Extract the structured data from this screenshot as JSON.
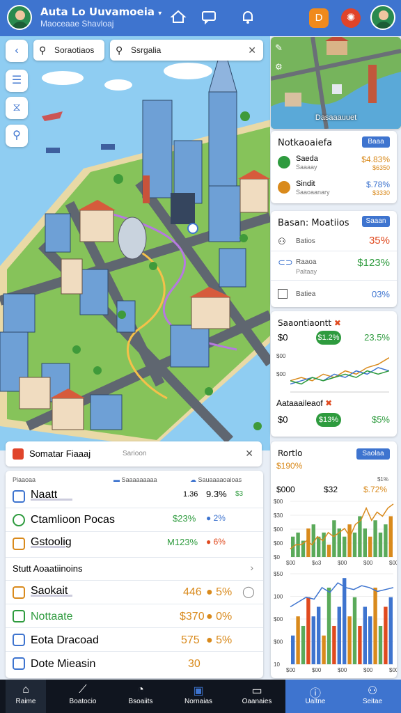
{
  "header": {
    "title": "Auta Lo Uuvamoeia",
    "title_suffix": "▾",
    "subtitle": "Maoceaae Shavloaj",
    "icons": [
      "home-icon",
      "chat-icon",
      "notification-icon",
      "document-icon",
      "settings-icon"
    ]
  },
  "search": {
    "left_text": "Soraotiaos",
    "right_text": "Ssrgalia"
  },
  "map": {
    "minimap_label": "Dasaaauuet"
  },
  "market_card": {
    "title": "Notkaoaiefa",
    "button": "Baaa",
    "rows": [
      {
        "name": "Saeda",
        "sub": "Saaaay",
        "value": "$4.83%",
        "sub_value": "$6350"
      },
      {
        "name": "Sindit",
        "sub": "Saaoaanary",
        "value": "$.78%",
        "sub_value": "$3330"
      }
    ]
  },
  "monitor_card": {
    "title": "Basan: Moatiios",
    "button": "Saaan",
    "rows": [
      {
        "name": "Batios",
        "value": "35%"
      },
      {
        "name": "Raaoa",
        "sub": "Paltaay",
        "value": "$123%"
      },
      {
        "name": "Batiea",
        "value": "03%"
      }
    ]
  },
  "stats_card": {
    "title": "Saaontiaontt",
    "flag": "✖",
    "a_label": "$0",
    "a_pill": "$1.2%",
    "a_value": "23.5%",
    "chart_ylabels": [
      "$00",
      "$00"
    ],
    "b_title": "Aataaaileaof",
    "b_label": "$0",
    "b_pill": "$13%",
    "b_value": "$5%"
  },
  "chart_data": [
    {
      "type": "line",
      "series": [
        {
          "values": [
            3,
            4,
            3,
            5,
            4,
            6,
            5,
            7,
            8,
            10
          ],
          "color": "#d98a1c"
        },
        {
          "values": [
            2,
            3,
            4,
            3,
            5,
            4,
            6,
            5,
            7,
            6
          ],
          "color": "#3e74cf"
        },
        {
          "values": [
            3,
            2,
            4,
            3,
            4,
            5,
            4,
            6,
            5,
            6
          ],
          "color": "#2e9b3e"
        }
      ]
    },
    {
      "type": "bar",
      "title": "Rortlo",
      "button": "Saolaa",
      "value": "$190%",
      "stats": [
        "$000",
        "$32",
        "$.72%"
      ],
      "stat_note": "$1%",
      "ylabels": [
        "$00",
        "$30",
        "$00",
        "$00",
        "$0"
      ],
      "xlabels": [
        "$00",
        "$o3",
        "$00",
        "$00",
        "$00"
      ],
      "values": [
        5,
        6,
        4,
        7,
        8,
        5,
        6,
        3,
        9,
        7,
        5,
        8,
        6,
        10,
        7,
        5,
        9,
        6,
        8,
        10
      ],
      "line": [
        2,
        3,
        3,
        4,
        3,
        5,
        4,
        6,
        5,
        6,
        7,
        5,
        8,
        9,
        12,
        9,
        11,
        10,
        12,
        13
      ]
    },
    {
      "type": "bar",
      "ylabels": [
        "$50",
        "100",
        "$00",
        "$00",
        "10"
      ],
      "xlabels": [
        "$00",
        "$00",
        "$00",
        "$00",
        "$00"
      ],
      "line": [
        6,
        6.5,
        7,
        6.8,
        8,
        7.5,
        8.5,
        8,
        7.8,
        8.2,
        8,
        7.6,
        7.8,
        8
      ],
      "values": [
        3,
        5,
        4,
        7,
        5,
        6,
        3,
        8,
        4,
        6,
        9,
        5,
        7,
        4,
        6,
        5,
        8,
        4,
        6,
        7
      ]
    }
  ],
  "panel": {
    "title": "Somatar Fiaaaj",
    "tag": "Sarioon",
    "col1": "Piaaoaa",
    "col2": "Saaaaaaaaa",
    "col3": "Sauaaaaoaioas",
    "rows": [
      {
        "name": "Naatt",
        "a": "1.36",
        "b": "9.3%",
        "c": "$3"
      },
      {
        "name": "Ctamlioon Pocas",
        "a": "$23%",
        "b": "2%"
      },
      {
        "name": "Gstoolig",
        "a": "M123%",
        "b": "6%"
      }
    ],
    "section": "Stutt Aoaatiinoins",
    "section_rows": [
      {
        "name": "Saokait",
        "a": "446",
        "b": "5%"
      },
      {
        "name": "Nottaate",
        "a": "$370",
        "b": "0%"
      },
      {
        "name": "Eota Dracoad",
        "a": "575",
        "b": "5%"
      },
      {
        "name": "Dote Mieasin",
        "a": "30"
      }
    ]
  },
  "nav": {
    "items": [
      "Raime",
      "Boatocio",
      "Bsoaiits",
      "Nornaias",
      "Oaanaies",
      "Ualtne",
      "Seitae"
    ]
  }
}
